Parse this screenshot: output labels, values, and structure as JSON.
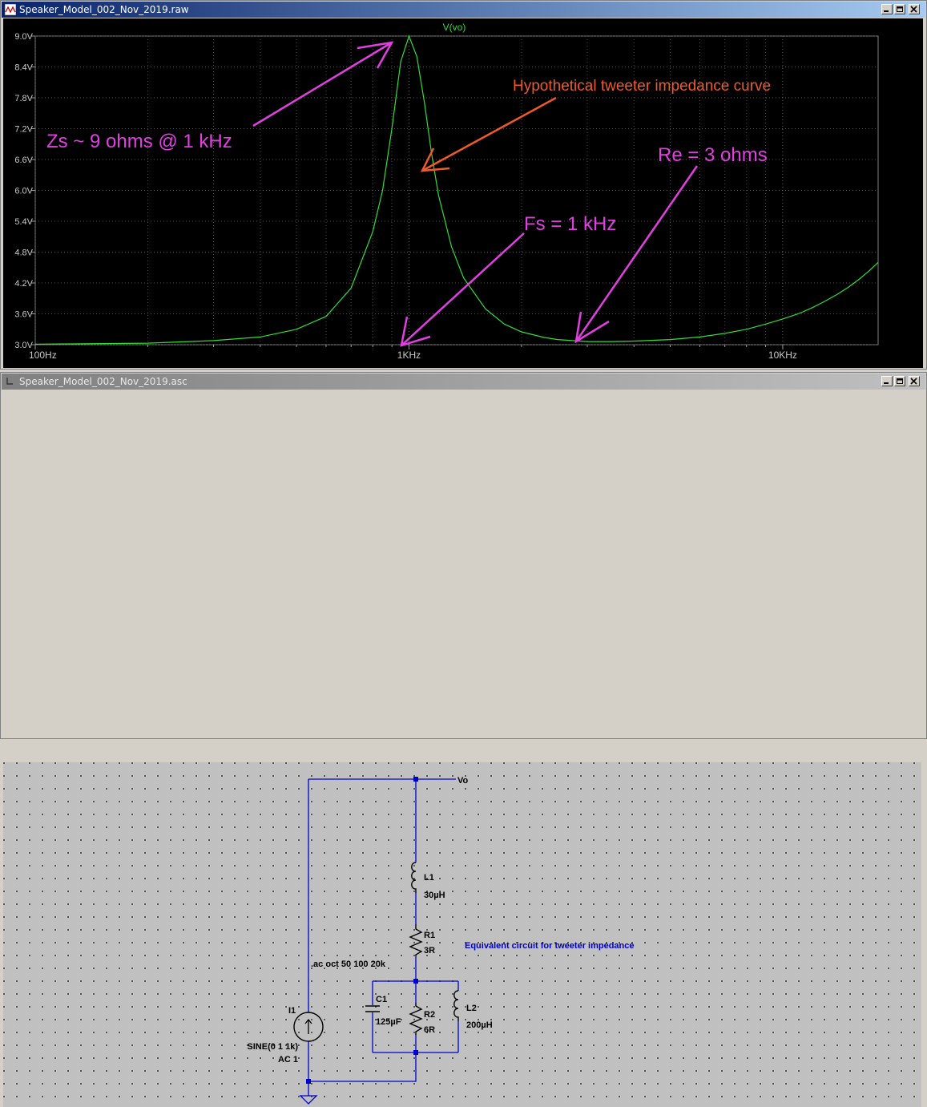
{
  "plot_window": {
    "title": "Speaker_Model_002_Nov_2019.raw",
    "trace_label": "V(vo)",
    "trace_color": "#33dd33",
    "y_ticks": [
      "9.0V",
      "8.4V",
      "7.8V",
      "7.2V",
      "6.6V",
      "6.0V",
      "5.4V",
      "4.8V",
      "4.2V",
      "3.6V",
      "3.0V"
    ],
    "x_ticks": [
      "100Hz",
      "1KHz",
      "10KHz"
    ],
    "annotations": {
      "zs": "Zs ~ 9 ohms @ 1 kHz",
      "curve": "Hypothetical tweeter impedance curve",
      "re": "Re = 3 ohms",
      "fs": "Fs = 1 kHz"
    },
    "annotation_colors": {
      "magenta": "#e040e0",
      "orange": "#f05a28"
    }
  },
  "chart_data": {
    "type": "line",
    "xlabel": "",
    "ylabel": "",
    "x_scale": "log",
    "xlim": [
      100,
      18000
    ],
    "ylim": [
      3.0,
      9.0
    ],
    "grid": true,
    "series": [
      {
        "name": "V(vo)",
        "x": [
          100,
          200,
          300,
          400,
          500,
          600,
          700,
          800,
          850,
          900,
          950,
          1000,
          1050,
          1100,
          1150,
          1200,
          1300,
          1400,
          1600,
          1800,
          2000,
          2300,
          2500,
          3000,
          3500,
          4000,
          5000,
          6000,
          7000,
          8000,
          9000,
          10000,
          11000,
          12000,
          13000,
          14000,
          15000,
          16000,
          17000,
          18000
        ],
        "y": [
          3.01,
          3.03,
          3.08,
          3.15,
          3.3,
          3.55,
          4.1,
          5.2,
          6.0,
          7.2,
          8.5,
          9.0,
          8.6,
          7.7,
          6.7,
          5.9,
          4.9,
          4.3,
          3.7,
          3.4,
          3.25,
          3.14,
          3.1,
          3.06,
          3.06,
          3.07,
          3.1,
          3.15,
          3.22,
          3.3,
          3.4,
          3.5,
          3.6,
          3.72,
          3.85,
          3.98,
          4.12,
          4.27,
          4.43,
          4.6
        ]
      }
    ]
  },
  "schematic_window": {
    "title": "Speaker_Model_002_Nov_2019.asc",
    "components": {
      "vo": "Vo",
      "l1_name": "L1",
      "l1_value": "30µH",
      "r1_name": "R1",
      "r1_value": "3R",
      "c1_name": "C1",
      "c1_value": "125µF",
      "r2_name": "R2",
      "r2_value": "6R",
      "l2_name": "L2",
      "l2_value": "200µH",
      "i1_name": "I1",
      "i1_value1": "SINE(0 1 1k)",
      "i1_value2": "AC 1",
      "directive": ".ac oct 50 100 20k",
      "comment": "Equivalent circuit for tweeter impedance"
    },
    "wire_color": "#0000cc",
    "comment_color": "#0000cc"
  }
}
